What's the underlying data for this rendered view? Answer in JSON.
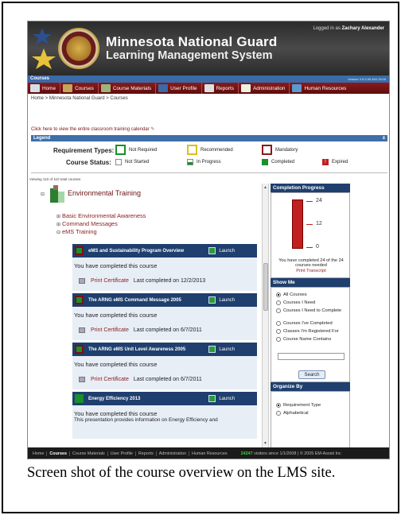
{
  "banner": {
    "title_line1": "Minnesota National Guard",
    "title_line2": "Learning Management System",
    "login_text": "Logged in as",
    "user_name": "Zachary Alexander",
    "version": "Version 3.9.3.90.440.15:00"
  },
  "courses_bar": {
    "label": "Courses"
  },
  "nav": {
    "items": [
      "Home",
      "Courses",
      "Course Materials",
      "User Profile",
      "Reports",
      "Administration",
      "Human Resources"
    ]
  },
  "breadcrumb": "Home > Minnesota National Guard > Courses",
  "calendar_link": "Click here to view the entire classroom training calendar",
  "legend": {
    "title": "Legend",
    "toggle": "±",
    "requirement_label": "Requirement Types:",
    "status_label": "Course Status:",
    "not_required": "Not Required",
    "recommended": "Recommended",
    "mandatory": "Mandatory",
    "not_started": "Not Started",
    "in_progress": "In Progress",
    "completed": "Completed",
    "expired": "Expired"
  },
  "viewing_text": "Viewing 110 of 110 total courses",
  "tree": {
    "group_label": "Environmental Training",
    "subgroups": [
      "Basic Environmental Awareness",
      "Command Messages",
      "eMS Training"
    ]
  },
  "courses": [
    {
      "name": "eMS and Sustainability Program Overview",
      "launch": "Launch",
      "message": "You have completed this course",
      "certificate": "Print Certificate",
      "last_completed": "Last completed on 12/2/2013"
    },
    {
      "name": "The ARNG eMS Command Message 2005",
      "launch": "Launch",
      "message": "You have completed this course",
      "certificate": "Print Certificate",
      "last_completed": "Last completed on 6/7/2011"
    },
    {
      "name": "The ARNG eMS Unit Level Awareness 2005",
      "launch": "Launch",
      "message": "You have completed this course",
      "certificate": "Print Certificate",
      "last_completed": "Last completed on 6/7/2011"
    },
    {
      "name": "Energy Efficiency 2013",
      "launch": "Launch",
      "message": "You have completed this course",
      "extra": "This presentation provides information on Energy Efficiency and"
    }
  ],
  "completion": {
    "title": "Completion Progress",
    "ticks": [
      "24",
      "12",
      "0"
    ],
    "progress_value": 24,
    "progress_max": 24,
    "done_text": "You have completed 24 of the 24 courses needed",
    "transcript": "Print Transcript"
  },
  "show_me": {
    "title": "Show Me",
    "options": [
      "All Courses",
      "Courses I Need",
      "Courses I Need to Complete",
      "Courses I've Completed",
      "Classes I'm Registered For",
      "Course Name Contains"
    ],
    "selected": "All Courses",
    "search_button": "Search"
  },
  "organize": {
    "title": "Organize By",
    "options": [
      "Requirement Type",
      "Alphabetical"
    ],
    "selected": "Requirement Type"
  },
  "footer": {
    "items": [
      "Home",
      "Courses",
      "Course Materials",
      "User Profile",
      "Reports",
      "Administration",
      "Human Resources"
    ],
    "visitor_count": "24247",
    "visitor_text": "visitors since 1/1/2008 | © 2005 EM-Assist Inc"
  },
  "caption": "Screen shot of the course overview on the LMS site.",
  "colors": {
    "nav_red": "#8b1a1a",
    "header_blue": "#1f3f6e",
    "legend_blue": "#3f6ea8",
    "completed_green": "#1a8f2a"
  }
}
